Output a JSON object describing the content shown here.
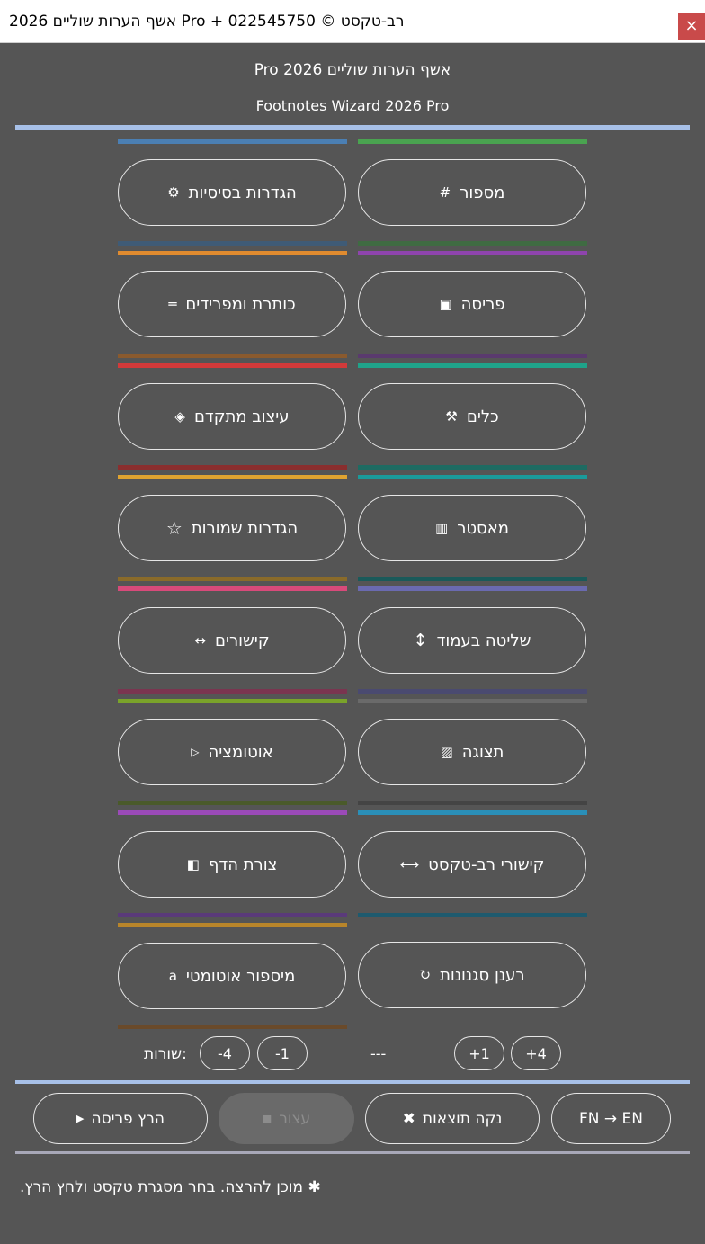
{
  "window": {
    "title": "רב-טקסט © 022545750 + Pro אשף הערות שוליים 2026",
    "close_glyph": "×"
  },
  "header": {
    "title_he": "Pro אשף הערות שוליים 2026",
    "title_en": "Footnotes Wizard 2026 Pro"
  },
  "colors": {
    "separator": "#a7c0e8",
    "background": "#555555"
  },
  "buttons": [
    {
      "label": "הגדרות בסיסיות",
      "icon": "⚙",
      "icon_name": "gear-icon"
    },
    {
      "label": "מספור",
      "icon": "#",
      "icon_name": "hash-icon"
    },
    {
      "label": "כותרת ומפרידים",
      "icon": "═",
      "icon_name": "separator-icon"
    },
    {
      "label": "פריסה",
      "icon": "▣",
      "icon_name": "layout-icon"
    },
    {
      "label": "עיצוב מתקדם",
      "icon": "◈",
      "icon_name": "diamond-icon"
    },
    {
      "label": "כלים",
      "icon": "⚒",
      "icon_name": "tools-icon"
    },
    {
      "label": "הגדרות שמורות",
      "icon": "☆",
      "icon_name": "star-icon"
    },
    {
      "label": "מאסטר",
      "icon": "▥",
      "icon_name": "master-icon"
    },
    {
      "label": "קישורים",
      "icon": "↔",
      "icon_name": "link-arrows-icon"
    },
    {
      "label": "שליטה בעמוד",
      "icon": "↕",
      "icon_name": "vertical-arrows-icon"
    },
    {
      "label": "אוטומציה",
      "icon": "▷",
      "icon_name": "play-outline-icon"
    },
    {
      "label": "תצוגה",
      "icon": "▨",
      "icon_name": "view-icon"
    },
    {
      "label": "צורת הדף",
      "icon": "◧",
      "icon_name": "page-shape-icon"
    },
    {
      "label": "קישורי רב-טקסט",
      "icon": "⟷",
      "icon_name": "long-arrows-icon"
    },
    {
      "label": "מיספור אוטומטי",
      "icon": "a",
      "icon_name": "letter-a-icon"
    },
    {
      "label": "רענן סגנונות",
      "icon": "↻",
      "icon_name": "refresh-icon"
    }
  ],
  "rows": {
    "label": "שורות:",
    "buttons": [
      "-4",
      "-1",
      "+1",
      "+4"
    ],
    "placeholder": "---"
  },
  "actions": {
    "run": {
      "label": "הרץ פריסה",
      "icon": "▶"
    },
    "stop": {
      "label": "עצור",
      "icon": "■"
    },
    "clear": {
      "label": "נקה תוצאות",
      "icon": "✖"
    },
    "fn_en": {
      "label": "FN → EN"
    }
  },
  "status": {
    "text": "מוכן להרצה. בחר מסגרת טקסט ולחץ הרץ.",
    "icon": "✱"
  }
}
